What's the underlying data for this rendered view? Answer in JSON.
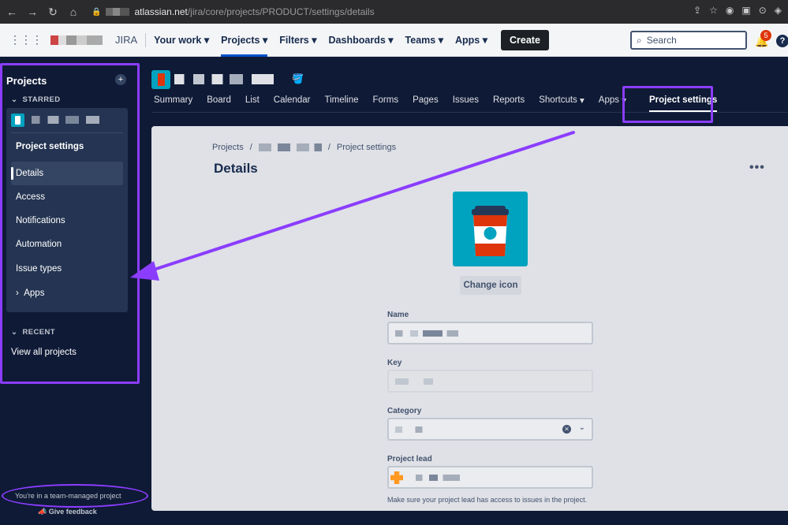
{
  "browser": {
    "url_host": "atlassian.net",
    "url_path": "/jira/core/projects/PRODUCT/settings/details"
  },
  "topnav": {
    "product_name": "JIRA",
    "items": [
      {
        "label": "Your work"
      },
      {
        "label": "Projects"
      },
      {
        "label": "Filters"
      },
      {
        "label": "Dashboards"
      },
      {
        "label": "Teams"
      },
      {
        "label": "Apps"
      }
    ],
    "active_item": "Projects",
    "create_label": "Create",
    "search_label": "Search",
    "notification_count": "5",
    "help_label": "?"
  },
  "sidebar": {
    "title": "Projects",
    "starred_label": "STARRED",
    "settings_heading": "Project settings",
    "items": [
      {
        "label": "Details"
      },
      {
        "label": "Access"
      },
      {
        "label": "Notifications"
      },
      {
        "label": "Automation"
      },
      {
        "label": "Issue types"
      },
      {
        "label": "Apps"
      }
    ],
    "selected_item": "Details",
    "recent_label": "RECENT",
    "view_all_label": "View all projects",
    "team_note": "You're in a team-managed project",
    "feedback_label": "Give feedback"
  },
  "project_tabs": {
    "items": [
      {
        "label": "Summary"
      },
      {
        "label": "Board"
      },
      {
        "label": "List"
      },
      {
        "label": "Calendar"
      },
      {
        "label": "Timeline"
      },
      {
        "label": "Forms"
      },
      {
        "label": "Pages"
      },
      {
        "label": "Issues"
      },
      {
        "label": "Reports"
      },
      {
        "label": "Shortcuts"
      },
      {
        "label": "Apps"
      },
      {
        "label": "Project settings"
      }
    ],
    "active_tab": "Project settings"
  },
  "main": {
    "breadcrumb_root": "Projects",
    "breadcrumb_sep": "/",
    "breadcrumb_current": "Project settings",
    "title": "Details",
    "more_label": "•••",
    "change_icon_label": "Change icon",
    "fields": {
      "name_label": "Name",
      "key_label": "Key",
      "category_label": "Category",
      "lead_label": "Project lead"
    },
    "lead_helper": "Make sure your project lead has access to issues in the project."
  },
  "colors": {
    "annotation": "#8b3dff",
    "sidebar_bg": "#0f1a36",
    "accent": "#0052cc",
    "project_icon_bg": "#00a3bf"
  }
}
